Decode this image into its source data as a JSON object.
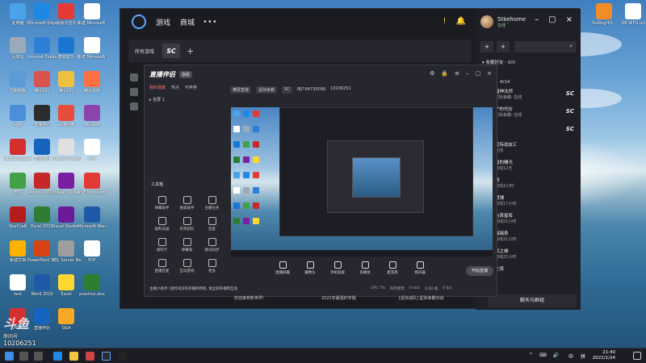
{
  "desktop": {
    "icons": [
      {
        "label": "此电脑",
        "color": "#4aa3e8"
      },
      {
        "label": "Microsoft Edge",
        "color": "#1e88e5"
      },
      {
        "label": "网易云音乐",
        "color": "#e53935"
      },
      {
        "label": "新建 Microsoft Word 文档",
        "color": "#ffffff"
      },
      {
        "label": "回收站",
        "color": "#9ab"
      },
      {
        "label": "Internet Explorer",
        "color": "#2e7fd8"
      },
      {
        "label": "酷狗音乐",
        "color": "#1976d2"
      },
      {
        "label": "新建 Microsoft Word 文档",
        "color": "#ffffff"
      },
      {
        "label": "控制面板",
        "color": "#5c9bd5"
      },
      {
        "label": "腾讯QQ",
        "color": "#d9534f"
      },
      {
        "label": "腾讯QQ",
        "color": "#f0c040"
      },
      {
        "label": "腾讯视频",
        "color": "#ff7043"
      },
      {
        "label": "网络",
        "color": "#4a8fd8"
      },
      {
        "label": "直播伴侣",
        "color": "#2c2c2c"
      },
      {
        "label": "百度网盘",
        "color": "#e74c3c"
      },
      {
        "label": "WinRAR",
        "color": "#8e44ad"
      },
      {
        "label": "Adobe Reader XI",
        "color": "#d32f2f"
      },
      {
        "label": "直播伴侣",
        "color": "#1565c0"
      },
      {
        "label": "Microsoft Word 2010",
        "color": "#e0e0e0"
      },
      {
        "label": "x64",
        "color": "#ffffff"
      },
      {
        "label": "微信",
        "color": "#43a047"
      },
      {
        "label": "Access 2010",
        "color": "#c62828"
      },
      {
        "label": "Visual Studio",
        "color": "#7b1fa2"
      },
      {
        "label": "新建 Microsoft 文档",
        "color": "#e53935"
      },
      {
        "label": "StarCraft",
        "color": "#b71c1c"
      },
      {
        "label": "Excel 2010",
        "color": "#2e7d32"
      },
      {
        "label": "Visual Studio Code",
        "color": "#6a1b9a"
      },
      {
        "label": "Microsoft Word 2010",
        "color": "#1e5aa8"
      },
      {
        "label": "新建文档",
        "color": "#ffb300"
      },
      {
        "label": "PowerPoint 2010",
        "color": "#d84315"
      },
      {
        "label": "SQL Server Manager",
        "color": "#9e9e9e"
      },
      {
        "label": "PDF",
        "color": "#ffffff"
      },
      {
        "label": "test",
        "color": "#ffffff"
      },
      {
        "label": "Word 2010",
        "color": "#1e5aa8"
      },
      {
        "label": "Excel",
        "color": "#fdd835"
      },
      {
        "label": "practice.xlsx",
        "color": "#2e7d32"
      },
      {
        "label": "PDF",
        "color": "#d32f2f"
      },
      {
        "label": "直播伴侣",
        "color": "#1565c0"
      },
      {
        "label": "Q&A",
        "color": "#f9a825"
      }
    ],
    "right_icons": [
      {
        "label": "SuAlogHO... ",
        "color": "#f28c28"
      },
      {
        "label": "DB INFO.txt",
        "color": "#ffffff"
      }
    ]
  },
  "app": {
    "nav": [
      "游戏",
      "商城"
    ],
    "nav_more": "•••",
    "tab_all_games": "所有游戏",
    "tab_sc": "SC",
    "tab_plus": "+",
    "top_right_icons": [
      "!",
      "🔔"
    ],
    "window_buttons": [
      "–",
      "▢",
      "×"
    ]
  },
  "rightpanel": {
    "profile_name": "Stkehome",
    "profile_status": "在线 ˅",
    "friends_header": "▾ 收藏好友 - 0/0",
    "counter": "4/14",
    "friends": [
      {
        "name": "魔神法师",
        "status": "星际争霸: 在线",
        "sc": "SC"
      },
      {
        "name": "子的代价",
        "status": "星际争霸: 在线",
        "sc": "SC"
      },
      {
        "name": "",
        "status": "",
        "sc": "SC"
      },
      {
        "name": "星际战友汇",
        "status": "在线",
        "sc": ""
      },
      {
        "name": "国的曙光",
        "status": "离线12天",
        "sc": ""
      },
      {
        "name": "晴",
        "status": "离线2小时",
        "sc": ""
      },
      {
        "name": "塑铺",
        "status": "离线17小时",
        "sc": ""
      },
      {
        "name": "吉首星辉",
        "status": "离线21小时",
        "sc": ""
      },
      {
        "name": "瑞瑞表",
        "status": "离线21小时",
        "sc": ""
      },
      {
        "name": "风之雄",
        "status": "离线21小时",
        "sc": ""
      },
      {
        "name": "之夜",
        "status": "",
        "sc": ""
      }
    ],
    "chat_button": "聊天与群组"
  },
  "tool": {
    "logo": "直播伴侣",
    "badge": "旗舰",
    "tabs": [
      "我的场景",
      "热点",
      "可卖券"
    ],
    "scene": "全屏 1",
    "tools_label": "工具箱",
    "tool_items": [
      "弹幕助手",
      "搜索助手",
      "主播任务",
      "福利派送",
      "开黑组队",
      "连麦",
      "福利卡",
      "弹幕墙",
      "歌词同步",
      "直播连麦",
      "互动游戏",
      "更多"
    ],
    "tip": "主播小助手: 短时间没有开播的特权, 请立即开播和互动",
    "info": [
      "横屏直播",
      "星际争霸",
      "SC",
      "用户84730098",
      "10206251"
    ],
    "controls": [
      "直播屏幕",
      "摄像头",
      "手机投屏",
      "多媒体",
      "麦克风",
      "扬声器"
    ],
    "start_button": "开始直播",
    "status": [
      "CPU 7%",
      "内存使用",
      "0 kb/s",
      "0.00 帧",
      "0 fps"
    ],
    "under_text": [
      "欢迎来到新世界!",
      "2022年最强的专题",
      "[星际战队] 星际争霸对战"
    ]
  },
  "taskbar": {
    "clock_time": "21:40",
    "clock_date": "2022/1/24",
    "lang": "中",
    "lang2": "拼",
    "sys": "^ ⌨ 🔊"
  },
  "watermark": {
    "logo": "斗鱼",
    "room_label": "房间号",
    "room_id": "10206251"
  }
}
